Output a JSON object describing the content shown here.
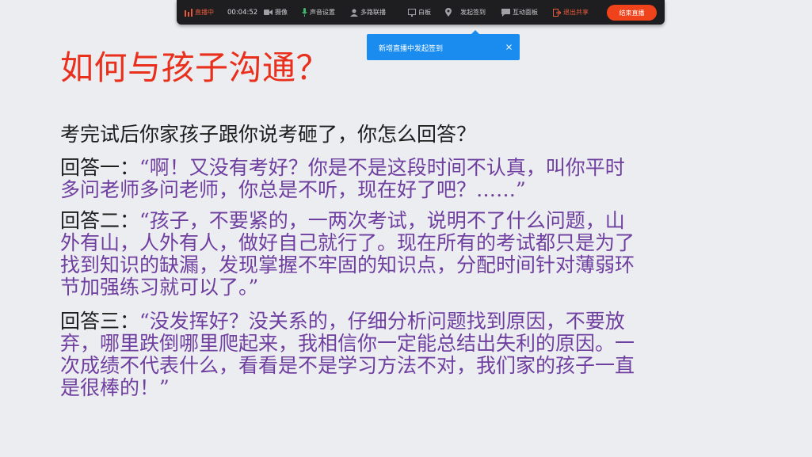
{
  "toolbar": {
    "live_label": "直播中",
    "timer": "00:04:52",
    "items": [
      {
        "label": "摄像",
        "icon": "camera-icon"
      },
      {
        "label": "声音设置",
        "icon": "microphone-icon"
      },
      {
        "label": "多路联播",
        "icon": "user-icon"
      },
      {
        "label": "白板",
        "icon": "whiteboard-icon"
      },
      {
        "label": "发起签到",
        "icon": "location-pin-icon"
      },
      {
        "label": "互动面板",
        "icon": "chat-icon"
      },
      {
        "label": "退出共享",
        "icon": "exit-share-icon"
      }
    ],
    "end_button": "结束直播",
    "accent": "#f0431c"
  },
  "toast": {
    "message": "新增直播中发起签到",
    "close": "×",
    "color": "#1a8cf0"
  },
  "slide": {
    "title": "如何与孩子沟通？",
    "title_color": "#e8301c",
    "question": "考完试后你家孩子跟你说考砸了，你怎么回答？",
    "answers": [
      {
        "label": "回答一：",
        "lines": [
          "“啊！又没有考好？你是不是这段时间不认真，叫你平时",
          "多问老师多问老师，你总是不听，现在好了吧？……”"
        ]
      },
      {
        "label": "回答二：",
        "lines": [
          "“孩子，不要紧的，一两次考试，说明不了什么问题，山",
          "外有山，人外有人，做好自己就行了。现在所有的考试都只是为了",
          "找到知识的缺漏，发现掌握不牢固的知识点，分配时间针对薄弱环",
          "节加强练习就可以了。”"
        ]
      },
      {
        "label": "回答三：",
        "lines": [
          "“没发挥好？没关系的，仔细分析问题找到原因，不要放",
          "弃，哪里跌倒哪里爬起来，我相信你一定能总结出失利的原因。一",
          "次成绩不代表什么，看看是不是学习方法不对，我们家的孩子一直",
          "是很棒的！”"
        ]
      },
      {}
    ],
    "quote_color": "#6f3fa0"
  }
}
